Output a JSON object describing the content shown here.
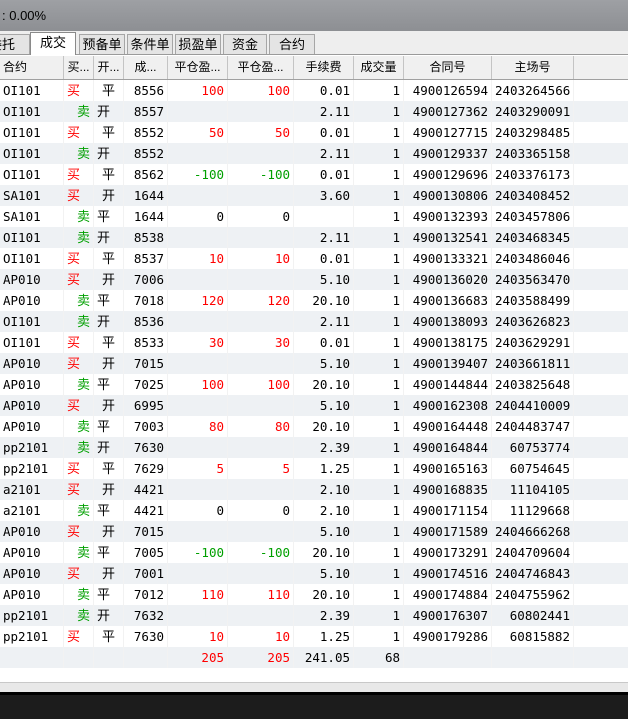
{
  "window": {
    "title": ": 0.00%"
  },
  "tabs": [
    {
      "label": "委托",
      "active": false
    },
    {
      "label": "成交",
      "active": true
    },
    {
      "label": "预备单",
      "active": false
    },
    {
      "label": "条件单",
      "active": false
    },
    {
      "label": "损盈单",
      "active": false
    },
    {
      "label": "资金",
      "active": false
    },
    {
      "label": "合约",
      "active": false
    }
  ],
  "columns": [
    "合约",
    "买...",
    "开...",
    "成...",
    "平仓盈...",
    "平仓盈...",
    "手续费",
    "成交量",
    "合同号",
    "主场号"
  ],
  "colors": {
    "buy": "#ff0000",
    "sell": "#00a000",
    "profit": "#ff0000",
    "loss": "#00a000"
  },
  "rows": [
    {
      "contract": "OI101",
      "side": "买",
      "oc": "平",
      "price": "8556",
      "pnl1": "100",
      "pnl2": "100",
      "fee": "0.01",
      "qty": "1",
      "order_no": "4900126594",
      "exch_no": "2403264566"
    },
    {
      "contract": "OI101",
      "side": "卖",
      "oc": "开",
      "price": "8557",
      "pnl1": "",
      "pnl2": "",
      "fee": "2.11",
      "qty": "1",
      "order_no": "4900127362",
      "exch_no": "2403290091"
    },
    {
      "contract": "OI101",
      "side": "买",
      "oc": "平",
      "price": "8552",
      "pnl1": "50",
      "pnl2": "50",
      "fee": "0.01",
      "qty": "1",
      "order_no": "4900127715",
      "exch_no": "2403298485"
    },
    {
      "contract": "OI101",
      "side": "卖",
      "oc": "开",
      "price": "8552",
      "pnl1": "",
      "pnl2": "",
      "fee": "2.11",
      "qty": "1",
      "order_no": "4900129337",
      "exch_no": "2403365158"
    },
    {
      "contract": "OI101",
      "side": "买",
      "oc": "平",
      "price": "8562",
      "pnl1": "-100",
      "pnl2": "-100",
      "fee": "0.01",
      "qty": "1",
      "order_no": "4900129696",
      "exch_no": "2403376173"
    },
    {
      "contract": "SA101",
      "side": "买",
      "oc": "开",
      "price": "1644",
      "pnl1": "",
      "pnl2": "",
      "fee": "3.60",
      "qty": "1",
      "order_no": "4900130806",
      "exch_no": "2403408452"
    },
    {
      "contract": "SA101",
      "side": "卖",
      "oc": "平",
      "price": "1644",
      "pnl1": "0",
      "pnl2": "0",
      "fee": "",
      "qty": "1",
      "order_no": "4900132393",
      "exch_no": "2403457806"
    },
    {
      "contract": "OI101",
      "side": "卖",
      "oc": "开",
      "price": "8538",
      "pnl1": "",
      "pnl2": "",
      "fee": "2.11",
      "qty": "1",
      "order_no": "4900132541",
      "exch_no": "2403468345"
    },
    {
      "contract": "OI101",
      "side": "买",
      "oc": "平",
      "price": "8537",
      "pnl1": "10",
      "pnl2": "10",
      "fee": "0.01",
      "qty": "1",
      "order_no": "4900133321",
      "exch_no": "2403486046"
    },
    {
      "contract": "AP010",
      "side": "买",
      "oc": "开",
      "price": "7006",
      "pnl1": "",
      "pnl2": "",
      "fee": "5.10",
      "qty": "1",
      "order_no": "4900136020",
      "exch_no": "2403563470"
    },
    {
      "contract": "AP010",
      "side": "卖",
      "oc": "平",
      "price": "7018",
      "pnl1": "120",
      "pnl2": "120",
      "fee": "20.10",
      "qty": "1",
      "order_no": "4900136683",
      "exch_no": "2403588499"
    },
    {
      "contract": "OI101",
      "side": "卖",
      "oc": "开",
      "price": "8536",
      "pnl1": "",
      "pnl2": "",
      "fee": "2.11",
      "qty": "1",
      "order_no": "4900138093",
      "exch_no": "2403626823"
    },
    {
      "contract": "OI101",
      "side": "买",
      "oc": "平",
      "price": "8533",
      "pnl1": "30",
      "pnl2": "30",
      "fee": "0.01",
      "qty": "1",
      "order_no": "4900138175",
      "exch_no": "2403629291"
    },
    {
      "contract": "AP010",
      "side": "买",
      "oc": "开",
      "price": "7015",
      "pnl1": "",
      "pnl2": "",
      "fee": "5.10",
      "qty": "1",
      "order_no": "4900139407",
      "exch_no": "2403661811"
    },
    {
      "contract": "AP010",
      "side": "卖",
      "oc": "平",
      "price": "7025",
      "pnl1": "100",
      "pnl2": "100",
      "fee": "20.10",
      "qty": "1",
      "order_no": "4900144844",
      "exch_no": "2403825648"
    },
    {
      "contract": "AP010",
      "side": "买",
      "oc": "开",
      "price": "6995",
      "pnl1": "",
      "pnl2": "",
      "fee": "5.10",
      "qty": "1",
      "order_no": "4900162308",
      "exch_no": "2404410009"
    },
    {
      "contract": "AP010",
      "side": "卖",
      "oc": "平",
      "price": "7003",
      "pnl1": "80",
      "pnl2": "80",
      "fee": "20.10",
      "qty": "1",
      "order_no": "4900164448",
      "exch_no": "2404483747"
    },
    {
      "contract": "pp2101",
      "side": "卖",
      "oc": "开",
      "price": "7630",
      "pnl1": "",
      "pnl2": "",
      "fee": "2.39",
      "qty": "1",
      "order_no": "4900164844",
      "exch_no": "60753774"
    },
    {
      "contract": "pp2101",
      "side": "买",
      "oc": "平",
      "price": "7629",
      "pnl1": "5",
      "pnl2": "5",
      "fee": "1.25",
      "qty": "1",
      "order_no": "4900165163",
      "exch_no": "60754645"
    },
    {
      "contract": "a2101",
      "side": "买",
      "oc": "开",
      "price": "4421",
      "pnl1": "",
      "pnl2": "",
      "fee": "2.10",
      "qty": "1",
      "order_no": "4900168835",
      "exch_no": "11104105"
    },
    {
      "contract": "a2101",
      "side": "卖",
      "oc": "平",
      "price": "4421",
      "pnl1": "0",
      "pnl2": "0",
      "fee": "2.10",
      "qty": "1",
      "order_no": "4900171154",
      "exch_no": "11129668"
    },
    {
      "contract": "AP010",
      "side": "买",
      "oc": "开",
      "price": "7015",
      "pnl1": "",
      "pnl2": "",
      "fee": "5.10",
      "qty": "1",
      "order_no": "4900171589",
      "exch_no": "2404666268"
    },
    {
      "contract": "AP010",
      "side": "卖",
      "oc": "平",
      "price": "7005",
      "pnl1": "-100",
      "pnl2": "-100",
      "fee": "20.10",
      "qty": "1",
      "order_no": "4900173291",
      "exch_no": "2404709604"
    },
    {
      "contract": "AP010",
      "side": "买",
      "oc": "开",
      "price": "7001",
      "pnl1": "",
      "pnl2": "",
      "fee": "5.10",
      "qty": "1",
      "order_no": "4900174516",
      "exch_no": "2404746843"
    },
    {
      "contract": "AP010",
      "side": "卖",
      "oc": "平",
      "price": "7012",
      "pnl1": "110",
      "pnl2": "110",
      "fee": "20.10",
      "qty": "1",
      "order_no": "4900174884",
      "exch_no": "2404755962"
    },
    {
      "contract": "pp2101",
      "side": "卖",
      "oc": "开",
      "price": "7632",
      "pnl1": "",
      "pnl2": "",
      "fee": "2.39",
      "qty": "1",
      "order_no": "4900176307",
      "exch_no": "60802441"
    },
    {
      "contract": "pp2101",
      "side": "买",
      "oc": "平",
      "price": "7630",
      "pnl1": "10",
      "pnl2": "10",
      "fee": "1.25",
      "qty": "1",
      "order_no": "4900179286",
      "exch_no": "60815882"
    }
  ],
  "totals": {
    "pnl1": "205",
    "pnl2": "205",
    "fee": "241.05",
    "qty": "68"
  }
}
